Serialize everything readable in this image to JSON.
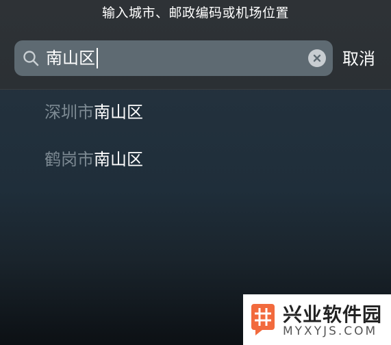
{
  "header": {
    "prompt": "输入城市、邮政编码或机场位置"
  },
  "search": {
    "value": "南山区",
    "cancel_label": "取消"
  },
  "results": [
    {
      "prefix": "深圳市",
      "match": "南山区"
    },
    {
      "prefix": "鹤岗市",
      "match": "南山区"
    }
  ],
  "watermark": {
    "name": "兴业软件园",
    "url": "MYXYJS.COM"
  },
  "colors": {
    "field_bg": "#5e6a72",
    "dim_text": "#7d8a93",
    "logo_accent": "#f26a3d"
  }
}
